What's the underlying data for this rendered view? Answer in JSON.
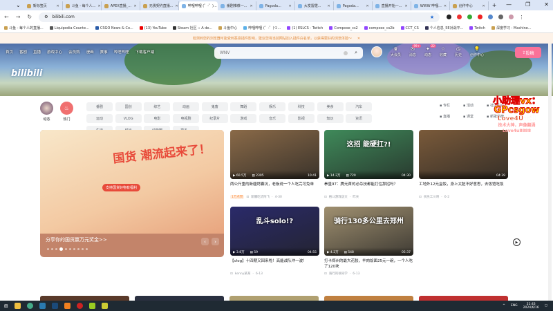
{
  "browser": {
    "tabs": [
      "新标签页",
      "斗鱼 - 每个人...",
      "APEX直播_...",
      "无畏契约直播...",
      "哔哩哔哩 (゜-゜)...",
      "番剧推荐一...",
      "Pagoda...",
      "大发雷霆...",
      "Pagoda...",
      "直播开始一...",
      "WWW 哔哩...",
      "创作中心"
    ],
    "active_tab": 4,
    "new_tab": "+",
    "url": "bilibili.com",
    "bookmarks": [
      "斗鱼 - 每个人的直播...",
      "Liquipedia Counte...",
      "CSGO News & Co...",
      "(13) YouTube",
      "Steam 社区 :: A de...",
      "斗鱼中心",
      "哔哩哔哩 (゜-゜)つ...",
      "(1) ESLCS - Twitch",
      "Compose_cs2",
      "compose_cs2b",
      "CCT_CS",
      "个人信息_5E对战平...",
      "Twitch",
      "深度学习 - Machine..."
    ],
    "window_controls": [
      "—",
      "❐",
      "✕"
    ]
  },
  "notice": {
    "text": "检测到您的浏览器可能受到恶意插件影响，建议您将当前网站加入插件白名单，以获得更好的浏览体验～",
    "close": "✕"
  },
  "header": {
    "nav": [
      "首页",
      "番剧",
      "直播",
      "游戏中心",
      "会员购",
      "漫画",
      "赛事",
      "哔哩哔哩",
      "下载客户端"
    ],
    "logo": "bilibili",
    "search_value": "WNV",
    "right": [
      {
        "label": "大会员"
      },
      {
        "label": "消息",
        "badge": "99+"
      },
      {
        "label": "动态",
        "badge": "22"
      },
      {
        "label": "收藏"
      },
      {
        "label": "历史"
      },
      {
        "label": "创作中心"
      }
    ],
    "upload": "投稿"
  },
  "channels": {
    "dynamic": "动态",
    "hot": "热门",
    "pills": [
      "番剧",
      "国创",
      "综艺",
      "动画",
      "鬼畜",
      "舞蹈",
      "娱乐",
      "科技",
      "美食",
      "汽车",
      "运动",
      "VLOG",
      "电影",
      "电视剧",
      "纪录片",
      "游戏",
      "音乐",
      "影视",
      "知识",
      "资讯",
      "生活",
      "时尚",
      "动物圈",
      "更多 ⌄"
    ],
    "links": [
      "专栏",
      "活动",
      "社区中心",
      "直播",
      "课堂",
      "新歌热榜"
    ]
  },
  "carousel": {
    "headline": "国货 潮流起来了！",
    "sub": "支持国货好物有福利",
    "caption": "分享你的国货赢万元奖金>>",
    "slides": 10,
    "active": 3
  },
  "videos": [
    {
      "views": "60.5万",
      "danmaku": "2305",
      "duration": "10:41",
      "title": "两公斤重的新疆烤囊坑，老板说一个人吃完可免单",
      "badge": "1万点赞",
      "author": "新疆吃货阿飞",
      "date": "4-30",
      "color": "#8a6a48"
    },
    {
      "views": "14.2万",
      "danmaku": "720",
      "duration": "04:30",
      "title": "拳皇97：腾元首的必杀技都能打住那招吗？",
      "author": "格斗游戏说文",
      "date": "昨天",
      "overlay": "这招 能硬扛?!",
      "color": "#3f8a5a"
    },
    {
      "views": "",
      "danmaku": "",
      "duration": "04:39",
      "title": "工地外12元盒饭，身上太脏不好意思，去饭馆吃饭",
      "author": "农民工川哥",
      "date": "6-2",
      "color": "#7a5a3a"
    },
    {
      "views": "3.8万",
      "danmaku": "59",
      "duration": "04:55",
      "title": "【vlog】十四期又回来啦！高能战队冲一波！",
      "author": "kenny某某",
      "date": "6-13",
      "overlay": "乱斗solo!?",
      "color": "#2a2a6a"
    },
    {
      "views": "4.2万",
      "danmaku": "548",
      "duration": "05:37",
      "title": "打卡郑州的最大花胶，羊肉烩面25元一碗，一个人吃了120块",
      "author": "骑行的徐同学",
      "date": "6-13",
      "overlay": "骑行130多公里去郑州",
      "color": "#a09070"
    }
  ],
  "watermark": [
    "小助理vx：",
    "GPcsgow",
    "Love4U大神",
    "技术大神，声像翻涌",
    "Love4u8888"
  ],
  "taskbar": {
    "lang": "ENG",
    "time": "21:43",
    "date": "2024/6/16"
  }
}
